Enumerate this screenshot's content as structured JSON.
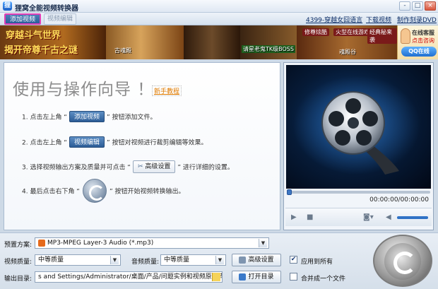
{
  "window": {
    "title": "狸窝全能视频转换器",
    "controls": [
      "-",
      "□",
      "×"
    ]
  },
  "menubar": {
    "add_video": "添加视频",
    "video_edit": "视频编辑",
    "links": [
      "4399-穿越女囧语言",
      "下载视频",
      "制作刻录DVD"
    ]
  },
  "banner": {
    "headline1": "穿越斗气世界",
    "headline2": "揭开帝尊千古之谜",
    "labels": [
      "古魂殿",
      "魂殿谷"
    ],
    "ad_bar": "请星老鬼TK级BOSS",
    "menu": [
      "修尊炫酷",
      "火型在线游戏",
      "经典秘来袭"
    ],
    "service": {
      "line1": "在线客服",
      "line2": "点击咨询",
      "qq": "QQ在线"
    }
  },
  "guide": {
    "title": "使用与操作向导 ！",
    "help_link": "新手教程",
    "step1_pre": "1. 点击左上角 “",
    "step1_btn": "添加视频",
    "step1_post": "” 按钮添加文件。",
    "step2_pre": "2. 点击左上角 “",
    "step2_btn": "视频编辑",
    "step2_post": "” 按钮对视频进行裁剪编辑等效果。",
    "step3_pre": "3. 选择视频输出方案及质量并可点击 “",
    "step3_btn": "高级设置",
    "step3_post": "” 进行详细的设置。",
    "step4_pre": "4. 最后点击右下角 “",
    "step4_post": "” 按钮开始视频转换输出。"
  },
  "player": {
    "time": "00:00:00/00:00:00",
    "progress": 0,
    "volume": 1.0
  },
  "settings": {
    "preset_label": "预置方案:",
    "preset_value": "MP3-MPEG Layer-3 Audio (*.mp3)",
    "video_quality_label": "视频质量:",
    "video_quality_value": "中等质量",
    "audio_quality_label": "音频质量:",
    "audio_quality_value": "中等质量",
    "advanced_btn": "高级设置",
    "apply_all": "应用到所有",
    "apply_all_checked": true,
    "output_label": "输出目录:",
    "output_value": "s and Settings/Administrator/桌面/产品/问题实例和视频原件/转换",
    "open_dir_btn": "打开目录",
    "merge": "合并成一个文件",
    "merge_checked": false
  }
}
